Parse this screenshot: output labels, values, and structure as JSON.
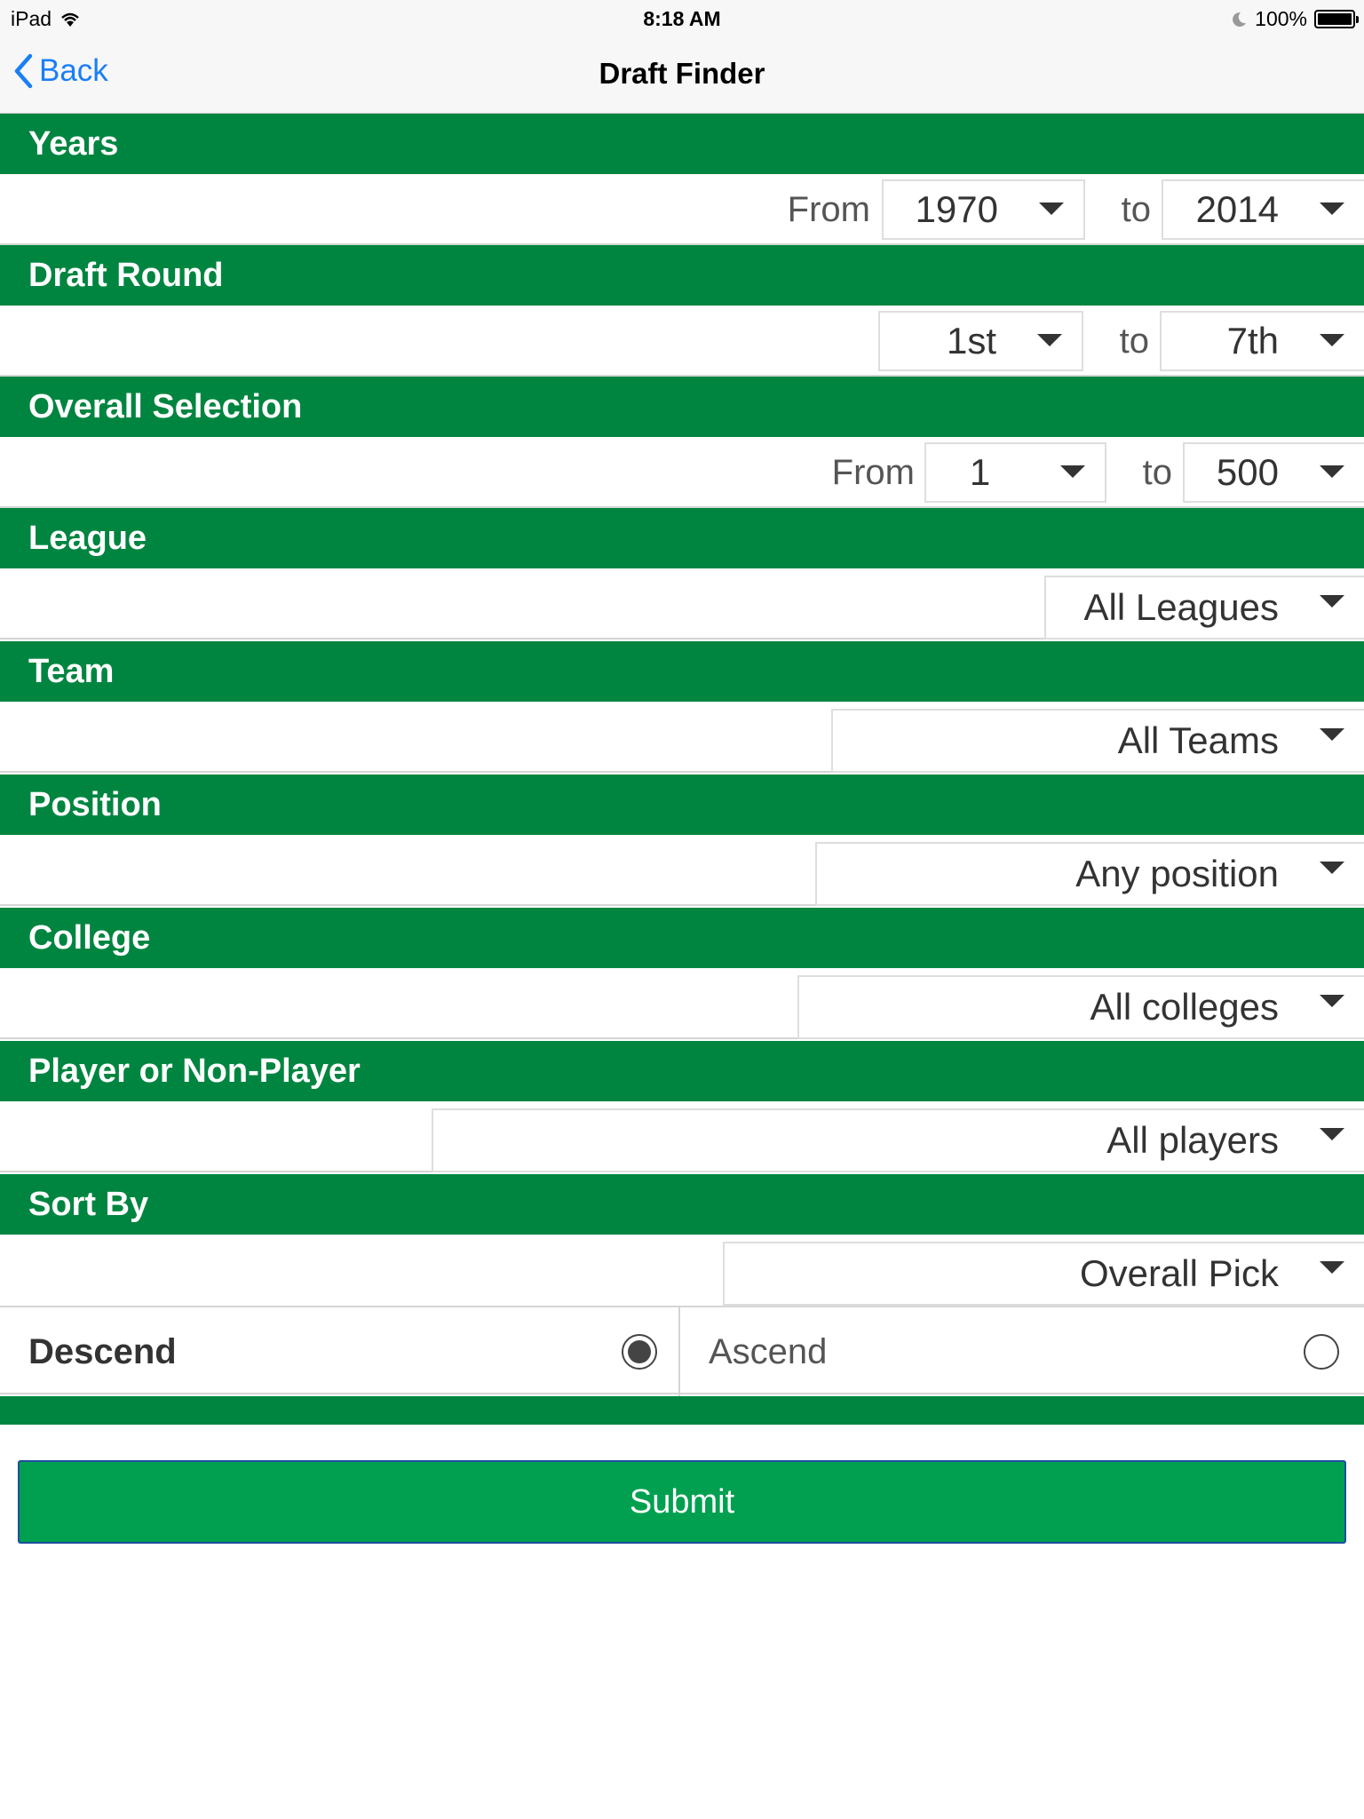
{
  "status_bar": {
    "device": "iPad",
    "time": "8:18 AM",
    "battery": "100%"
  },
  "nav": {
    "back_label": "Back",
    "title": "Draft Finder"
  },
  "years": {
    "header": "Years",
    "from_label": "From",
    "from_value": "1970",
    "to_label": "to",
    "to_value": "2014"
  },
  "draft_round": {
    "header": "Draft Round",
    "from_value": "1st",
    "to_label": "to",
    "to_value": "7th"
  },
  "overall_selection": {
    "header": "Overall Selection",
    "from_label": "From",
    "from_value": "1",
    "to_label": "to",
    "to_value": "500"
  },
  "league": {
    "header": "League",
    "value": "All Leagues"
  },
  "team": {
    "header": "Team",
    "value": "All Teams"
  },
  "position": {
    "header": "Position",
    "value": "Any position"
  },
  "college": {
    "header": "College",
    "value": "All colleges"
  },
  "player_type": {
    "header": "Player or Non-Player",
    "value": "All players"
  },
  "sort_by": {
    "header": "Sort By",
    "value": "Overall Pick"
  },
  "order": {
    "descend_label": "Descend",
    "descend_selected": true,
    "ascend_label": "Ascend",
    "ascend_selected": false
  },
  "submit_label": "Submit",
  "colors": {
    "section_green": "#008540",
    "button_green": "#00a050",
    "ios_blue": "#1a7ef5"
  }
}
